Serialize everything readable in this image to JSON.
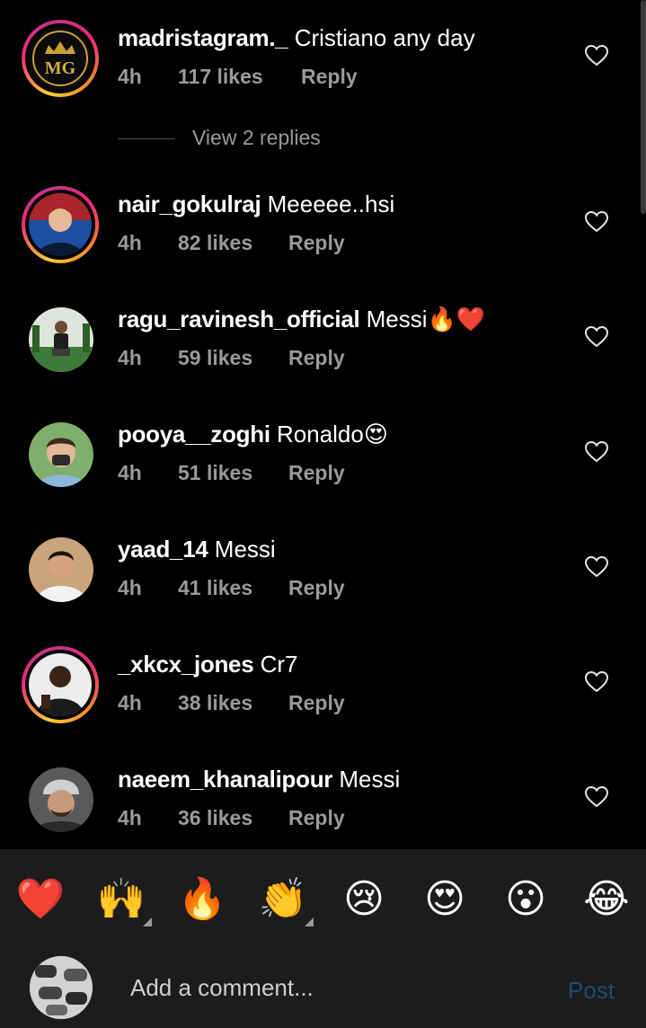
{
  "comments": [
    {
      "username": "madristagram._",
      "text": "Cristiano any day",
      "time": "4h",
      "likes": "117 likes",
      "reply": "Reply",
      "story": true,
      "avatar": "mg-logo"
    },
    {
      "username": "nair_gokulraj",
      "text": "Meeeee..hsi",
      "time": "4h",
      "likes": "82 likes",
      "reply": "Reply",
      "story": true,
      "avatar": "photo"
    },
    {
      "username": "ragu_ravinesh_official",
      "text": "Messi🔥❤️",
      "time": "4h",
      "likes": "59 likes",
      "reply": "Reply",
      "story": false,
      "avatar": "photo"
    },
    {
      "username": "pooya__zoghi",
      "text": "Ronaldo😍",
      "time": "4h",
      "likes": "51 likes",
      "reply": "Reply",
      "story": false,
      "avatar": "photo"
    },
    {
      "username": "yaad_14",
      "text": "Messi",
      "time": "4h",
      "likes": "41 likes",
      "reply": "Reply",
      "story": false,
      "avatar": "photo"
    },
    {
      "username": "_xkcx_jones",
      "text": "Cr7",
      "time": "4h",
      "likes": "38 likes",
      "reply": "Reply",
      "story": true,
      "avatar": "photo"
    },
    {
      "username": "naeem_khanalipour",
      "text": "Messi",
      "time": "4h",
      "likes": "36 likes",
      "reply": "Reply",
      "story": false,
      "avatar": "photo"
    }
  ],
  "view_replies": "View 2 replies",
  "reactions": [
    "❤️",
    "🙌",
    "🔥",
    "👏",
    "😢",
    "😍",
    "😮",
    "😂"
  ],
  "composer": {
    "placeholder": "Add a comment...",
    "post": "Post"
  },
  "colors": {
    "background": "#000000",
    "meta": "#9a9a9a",
    "panel": "#1c1c1c",
    "post_disabled": "#1f4a78"
  },
  "icons": {
    "like": "heart-outline-icon",
    "variant": "skin-tone-triangle-icon"
  }
}
